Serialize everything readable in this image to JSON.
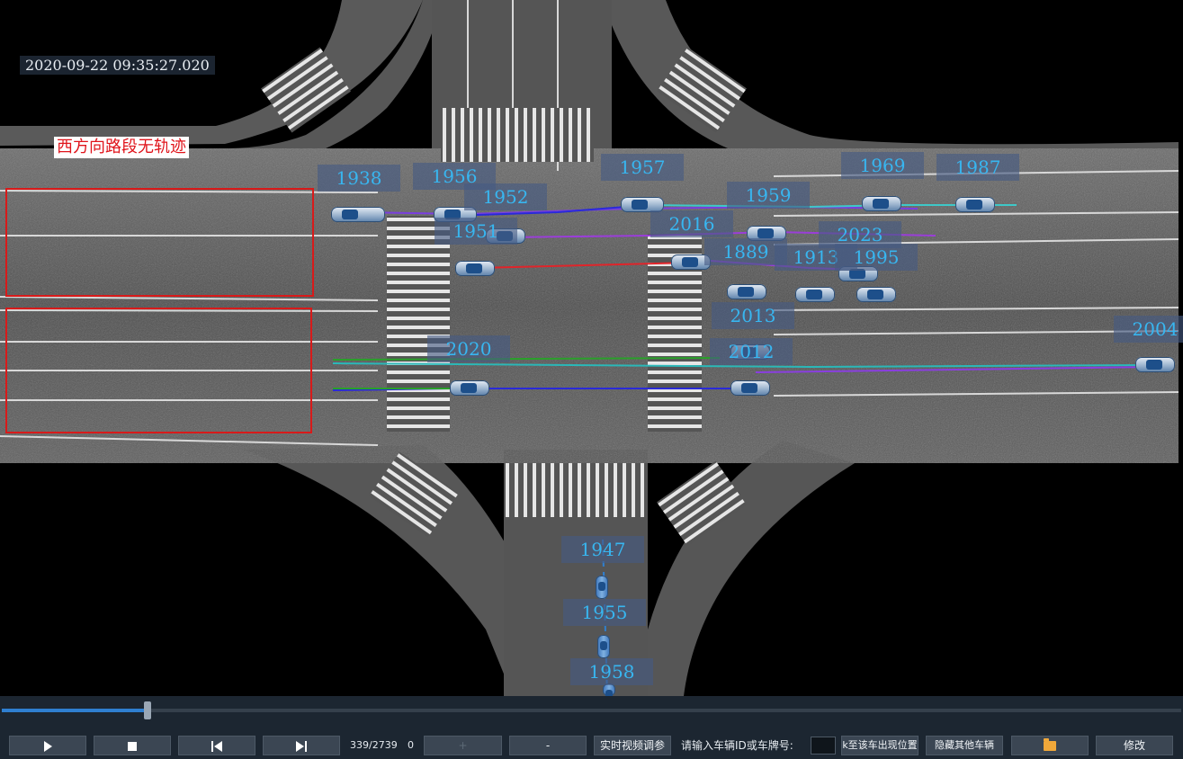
{
  "timestamp": "2020-09-22 09:35:27.020",
  "warning_text": "西方向路段无轨迹",
  "colors": {
    "roi_border": "#d81a1a",
    "label_text": "#38b6f0",
    "progress": "#2f7fd0"
  },
  "vehicles": [
    "1938",
    "1956",
    "1952",
    "1951",
    "1957",
    "1959",
    "2016",
    "1889",
    "1969",
    "1987",
    "2023",
    "1913",
    "1995",
    "2013",
    "2004",
    "2020",
    "2012",
    "1947",
    "1955",
    "1958"
  ],
  "player": {
    "play_icon": "play-icon",
    "stop_icon": "stop-icon",
    "prev_icon": "skip-back-icon",
    "next_icon": "skip-forward-icon",
    "frame": "339/2739",
    "frame_current": 339,
    "frame_total": 2739,
    "counter": "0",
    "plus_label": "+",
    "minus_label": "-",
    "realtime_label": "实时视频调参",
    "vehicle_prompt": "请输入车辆ID或车牌号:",
    "vehicle_value": "",
    "jump_label": "k至该车出现位置",
    "hide_label": "隐藏其他车辆",
    "folder_icon": "folder-icon",
    "edit_label": "修改"
  }
}
